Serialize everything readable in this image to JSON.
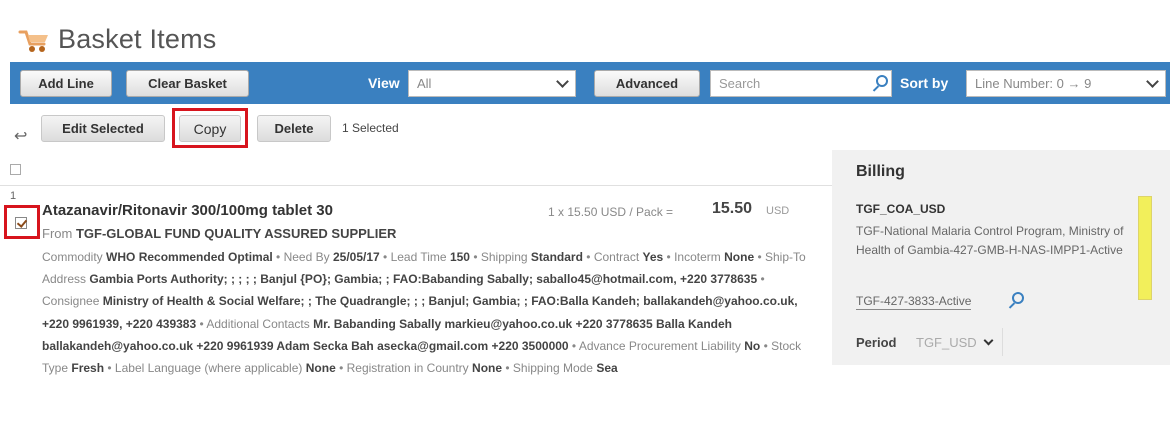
{
  "page": {
    "title": "Basket Items"
  },
  "toolbar": {
    "add_line": "Add Line",
    "clear_basket": "Clear Basket",
    "view_label": "View",
    "view_value": "All",
    "advanced": "Advanced",
    "search_placeholder": "Search",
    "sort_label": "Sort by",
    "sort_value": "Line Number: 0 → 9"
  },
  "actions": {
    "edit_selected": "Edit Selected",
    "copy": "Copy",
    "delete": "Delete",
    "selected_count": "1 Selected"
  },
  "billing": {
    "title": "Billing",
    "code": "TGF_COA_USD",
    "description": "TGF-National Malaria Control Program, Ministry of Health of Gambia-427-GMB-H-NAS-IMPP1-Active",
    "link": "TGF-427-3833-Active",
    "period_label": "Period",
    "period_value": "TGF_USD"
  },
  "item": {
    "line_number": "1",
    "name": "Atazanavir/Ritonavir 300/100mg tablet 30",
    "price_calc": "1 x 15.50 USD / Pack =",
    "price_total": "15.50",
    "currency": "USD",
    "supplier_prefix": "From",
    "supplier": "TGF-GLOBAL FUND QUALITY ASSURED SUPPLIER",
    "fields": [
      {
        "label": "Commodity",
        "value": "WHO Recommended Optimal"
      },
      {
        "label": "Need By",
        "value": "25/05/17"
      },
      {
        "label": "Lead Time",
        "value": "150"
      },
      {
        "label": "Shipping",
        "value": "Standard"
      },
      {
        "label": "Contract",
        "value": "Yes"
      },
      {
        "label": "Incoterm",
        "value": "None"
      },
      {
        "label": "Ship-To Address",
        "value": "Gambia Ports Authority; ; ; ; ; Banjul {PO}; Gambia; ; FAO:Babanding Sabally; saballo45@hotmail.com, +220 3778635"
      },
      {
        "label": "Consignee",
        "value": "Ministry of Health & Social Welfare; ; The Quadrangle; ; ; Banjul; Gambia; ; FAO:Balla Kandeh; ballakandeh@yahoo.co.uk, +220 9961939, +220 439383"
      },
      {
        "label": "Additional Contacts",
        "value": "Mr. Babanding Sabally markieu@yahoo.co.uk +220 3778635 Balla Kandeh ballakandeh@yahoo.co.uk +220 9961939 Adam Secka Bah asecka@gmail.com +220 3500000"
      },
      {
        "label": "Advance Procurement Liability",
        "value": "No"
      },
      {
        "label": "Stock Type",
        "value": "Fresh"
      },
      {
        "label": "Label Language (where applicable)",
        "value": "None"
      },
      {
        "label": "Registration in Country",
        "value": "None"
      },
      {
        "label": "Shipping Mode",
        "value": "Sea"
      }
    ]
  },
  "colors": {
    "toolbar_bg": "#3a80c0",
    "highlight": "#d7141d",
    "billing_bg": "#f1f1f1",
    "yellow_marker": "#f2ef5b"
  }
}
